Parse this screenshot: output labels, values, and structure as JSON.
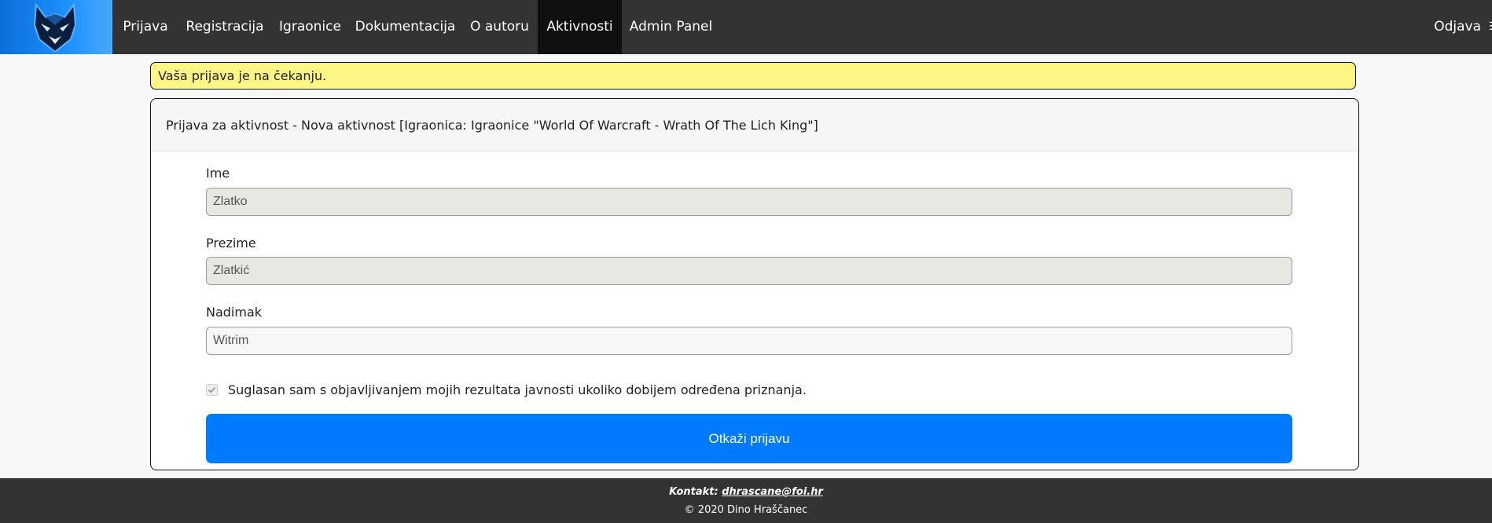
{
  "nav": {
    "logo_icon": "wolf-logo-icon",
    "items": [
      {
        "label": "Prijava"
      },
      {
        "label": "Registracija"
      },
      {
        "label": "Igraonice"
      },
      {
        "label": "Dokumentacija"
      },
      {
        "label": "O autoru"
      },
      {
        "label": "Aktivnosti",
        "active": true
      },
      {
        "label": "Admin Panel"
      }
    ],
    "logout_label": "Odjava"
  },
  "alert": {
    "text": "Vaša prijava je na čekanju."
  },
  "card": {
    "header": "Prijava za aktivnost - Nova aktivnost [Igraonica: Igraonice \"World Of Warcraft - Wrath Of The Lich King\"]",
    "fields": [
      {
        "label": "Ime",
        "value": "Zlatko"
      },
      {
        "label": "Prezime",
        "value": "Zlatkić"
      },
      {
        "label": "Nadimak",
        "value": "Witrim"
      }
    ],
    "consent": {
      "text": "Suglasan sam s objavljivanjem mojih rezultata javnosti ukoliko dobijem određena priznanja.",
      "checked": true
    },
    "submit_label": "Otkaži prijavu"
  },
  "footer": {
    "contact_prefix": "Kontakt:",
    "contact_email": "dhrascane@foi.hr",
    "copyright": "© 2020 Dino Hraščanec"
  },
  "colors": {
    "navbar": "#333333",
    "active_nav": "#0f0f0f",
    "alert_bg": "#fdf684",
    "primary_button": "#007bff",
    "logo_bg": "#1e90ff"
  }
}
